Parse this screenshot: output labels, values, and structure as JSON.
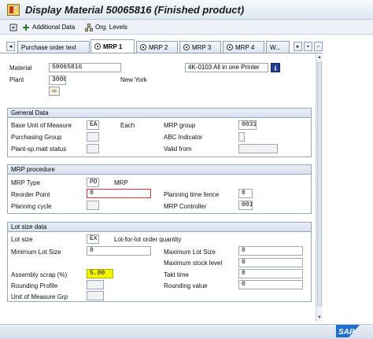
{
  "window": {
    "title": "Display Material 50065816 (Finished product)"
  },
  "appbar": {
    "additional_data": "Additional Data",
    "org_levels": "Org. Levels"
  },
  "tabs": [
    {
      "label": "Purchase order text",
      "active": false
    },
    {
      "label": "MRP 1",
      "active": true
    },
    {
      "label": "MRP 2",
      "active": false
    },
    {
      "label": "MRP 3",
      "active": false
    },
    {
      "label": "MRP 4",
      "active": false
    },
    {
      "label": "W...",
      "active": false
    }
  ],
  "header": {
    "material_label": "Material",
    "material_value": "50065816",
    "material_desc": "4K-0103 All in one Printer",
    "plant_label": "Plant",
    "plant_value": "3000",
    "plant_desc": "New York"
  },
  "general": {
    "title": "General Data",
    "base_uom_label": "Base Unit of Measure",
    "base_uom_value": "EA",
    "base_uom_desc": "Each",
    "purch_group_label": "Purchasing Group",
    "purch_group_value": "",
    "plant_status_label": "Plant-sp.matl status",
    "plant_status_value": "",
    "mrp_group_label": "MRP group",
    "mrp_group_value": "0031",
    "abc_label": "ABC Indicator",
    "abc_value": "",
    "valid_from_label": "Valid from",
    "valid_from_value": ""
  },
  "mrp_procedure": {
    "title": "MRP procedure",
    "mrp_type_label": "MRP Type",
    "mrp_type_value": "PD",
    "mrp_type_desc": "MRP",
    "reorder_label": "Reorder Point",
    "reorder_value": "0",
    "planning_cycle_label": "Planning cycle",
    "planning_cycle_value": "",
    "fence_label": "Planning time fence",
    "fence_value": "0",
    "controller_label": "MRP Controller",
    "controller_value": "001"
  },
  "lot_size": {
    "title": "Lot size data",
    "lot_size_label": "Lot size",
    "lot_size_value": "EX",
    "lot_size_desc": "Lot-for-lot order quantity",
    "min_lot_label": "Minimum Lot Size",
    "min_lot_value": "0",
    "max_lot_label": "Maximum Lot Size",
    "max_lot_value": "0",
    "max_stock_label": "Maximum stock level",
    "max_stock_value": "0",
    "scrap_label": "Assembly scrap (%)",
    "scrap_value": "5.00",
    "takt_label": "Takt time",
    "takt_value": "0",
    "rounding_profile_label": "Rounding Profile",
    "rounding_profile_value": "",
    "rounding_value_label": "Rounding value",
    "rounding_value_value": "0",
    "uom_grp_label": "Unit of Measure Grp",
    "uom_grp_value": ""
  },
  "branding": {
    "logo_text": "SAP"
  }
}
